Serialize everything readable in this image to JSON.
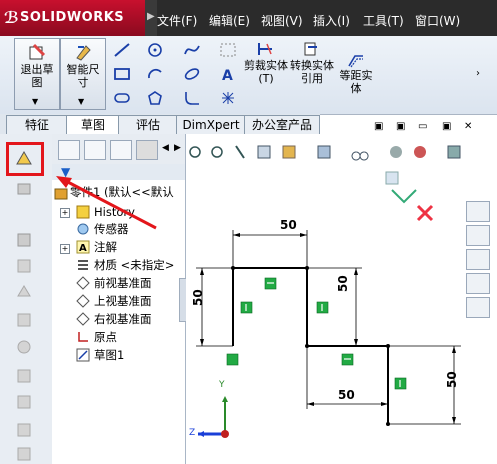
{
  "app": {
    "logo_text": "SOLIDWORKS",
    "logo_prefix": "3S"
  },
  "menu": [
    "文件(F)",
    "编辑(E)",
    "视图(V)",
    "插入(I)",
    "工具(T)",
    "窗口(W)"
  ],
  "toolbar": {
    "exit_sketch": "退出草图",
    "smart_dimension": "智能尺寸",
    "trim_entities": "剪裁实体(T)",
    "convert_entities": "转换实体引用",
    "offset_entities": "等距实体"
  },
  "tabs": [
    "特征",
    "草图",
    "评估",
    "DimXpert",
    "办公室产品"
  ],
  "tree": {
    "root": "零件1 (默认<<默认",
    "items": [
      "History",
      "传感器",
      "注解",
      "材质 <未指定>",
      "前视基准面",
      "上视基准面",
      "右视基准面",
      "原点",
      "草图1"
    ]
  },
  "dimensions": {
    "top": "50",
    "right_upper": "50",
    "bottom": "50",
    "right_lower": "50",
    "left_partial": "50"
  },
  "triad": {
    "y": "Y",
    "z": "Z"
  },
  "colors": {
    "title_bar": "#2b2b2b",
    "logo": "#c8102e",
    "highlight": "#e3161b",
    "relation": "#22aa44"
  }
}
